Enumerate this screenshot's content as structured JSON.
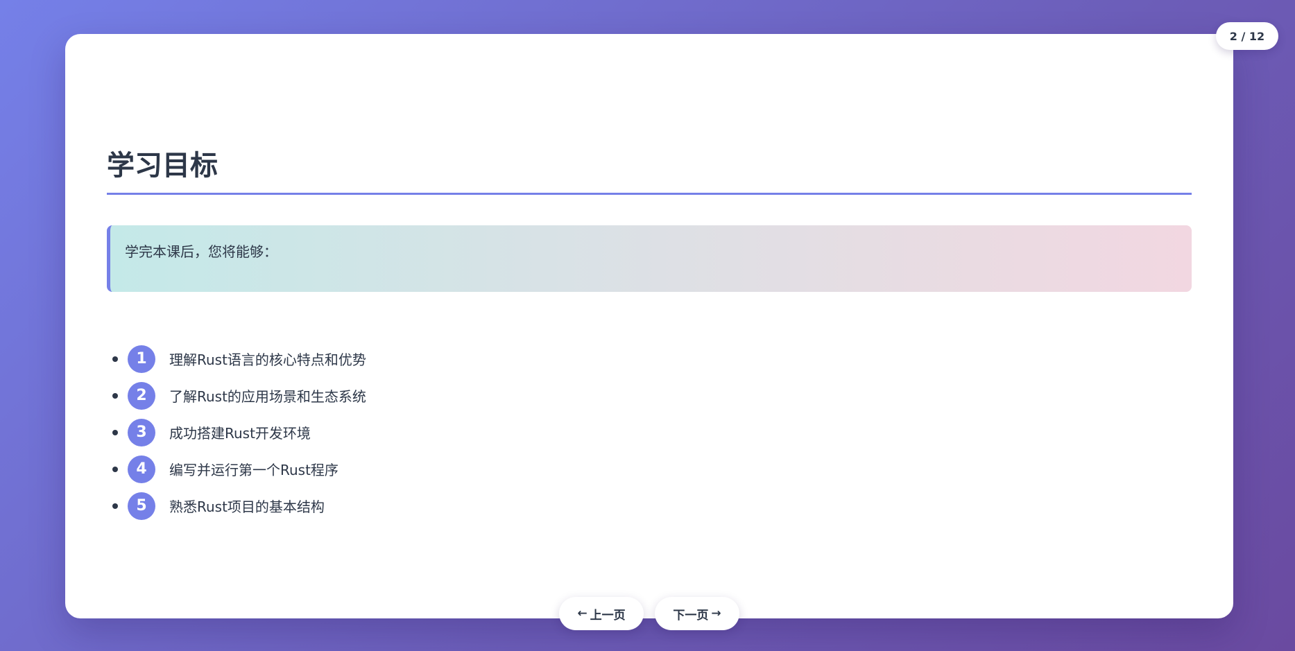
{
  "page_counter": "2 / 12",
  "slide": {
    "title": "学习目标",
    "intro": "学完本课后，您将能够：",
    "objectives": [
      {
        "number": "1",
        "text": "理解Rust语言的核心特点和优势"
      },
      {
        "number": "2",
        "text": "了解Rust的应用场景和生态系统"
      },
      {
        "number": "3",
        "text": "成功搭建Rust开发环境"
      },
      {
        "number": "4",
        "text": "编写并运行第一个Rust程序"
      },
      {
        "number": "5",
        "text": "熟悉Rust项目的基本结构"
      }
    ]
  },
  "nav": {
    "prev_label": "上一页",
    "next_label": "下一页",
    "prev_icon": "arrow-left",
    "next_icon": "arrow-right"
  },
  "colors": {
    "accent": "#7580e8",
    "text": "#2d3748"
  }
}
